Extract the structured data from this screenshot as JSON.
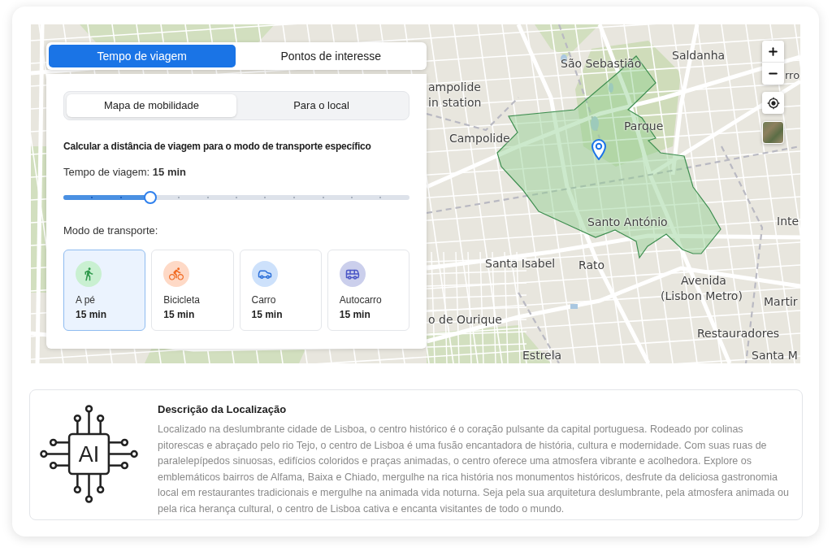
{
  "map": {
    "labels": [
      "São Sebastião",
      "Saldanha",
      "rro",
      "ampolide",
      "in station",
      "Campolide",
      "Parque",
      "Santo António",
      "Inte",
      "Santa Isabel",
      "Rato",
      "Avenida",
      "(Lisbon Metro)",
      "Martir",
      "o de Ourique",
      "Restauradores",
      "Estrela",
      "Santa M"
    ]
  },
  "panel": {
    "tabs": [
      {
        "label": "Tempo de viagem",
        "selected": true
      },
      {
        "label": "Pontos de interesse",
        "selected": false
      }
    ],
    "views": [
      {
        "label": "Mapa de mobilidade",
        "selected": true
      },
      {
        "label": "Para o local",
        "selected": false
      }
    ],
    "heading": "Calcular a distância de viagem para o modo de transporte específico",
    "travel_time": {
      "text": "Tempo de viagem: **15 min**",
      "level": 0.25
    },
    "transport_label": "Modo de transporte:",
    "transport_modes": [
      {
        "kind": "walk",
        "label": "A pé",
        "time": "15 min",
        "selected": true
      },
      {
        "kind": "bike",
        "label": "Bicicleta",
        "time": "15 min",
        "selected": false
      },
      {
        "kind": "car",
        "label": "Carro",
        "time": "15 min",
        "selected": false
      },
      {
        "kind": "bus",
        "label": "Autocarro",
        "time": "15 min",
        "selected": false
      }
    ]
  },
  "description": {
    "icon_label": "AI",
    "title": "Descrição da Localização",
    "text": "Localizado na deslumbrante cidade de Lisboa, o centro histórico é o coração pulsante da capital portuguesa. Rodeado por colinas pitorescas e abraçado pelo rio Tejo, o centro de Lisboa é uma fusão encantadora de história, cultura e modernidade. Com suas ruas de paralelepípedos sinuosas, edifícios coloridos e praças animadas, o centro oferece uma atmosfera vibrante e acolhedora. Explore os emblemáticos bairros de Alfama, Baixa e Chiado, mergulhe na rica história nos monumentos históricos, desfrute da deliciosa gastronomia local em restaurantes tradicionais e mergulhe na animada vida noturna. Seja pela sua arquitetura deslumbrante, pela atmosfera animada ou pela rica herança cultural, o centro de Lisboa cativa e encanta visitantes de todo o mundo."
  }
}
